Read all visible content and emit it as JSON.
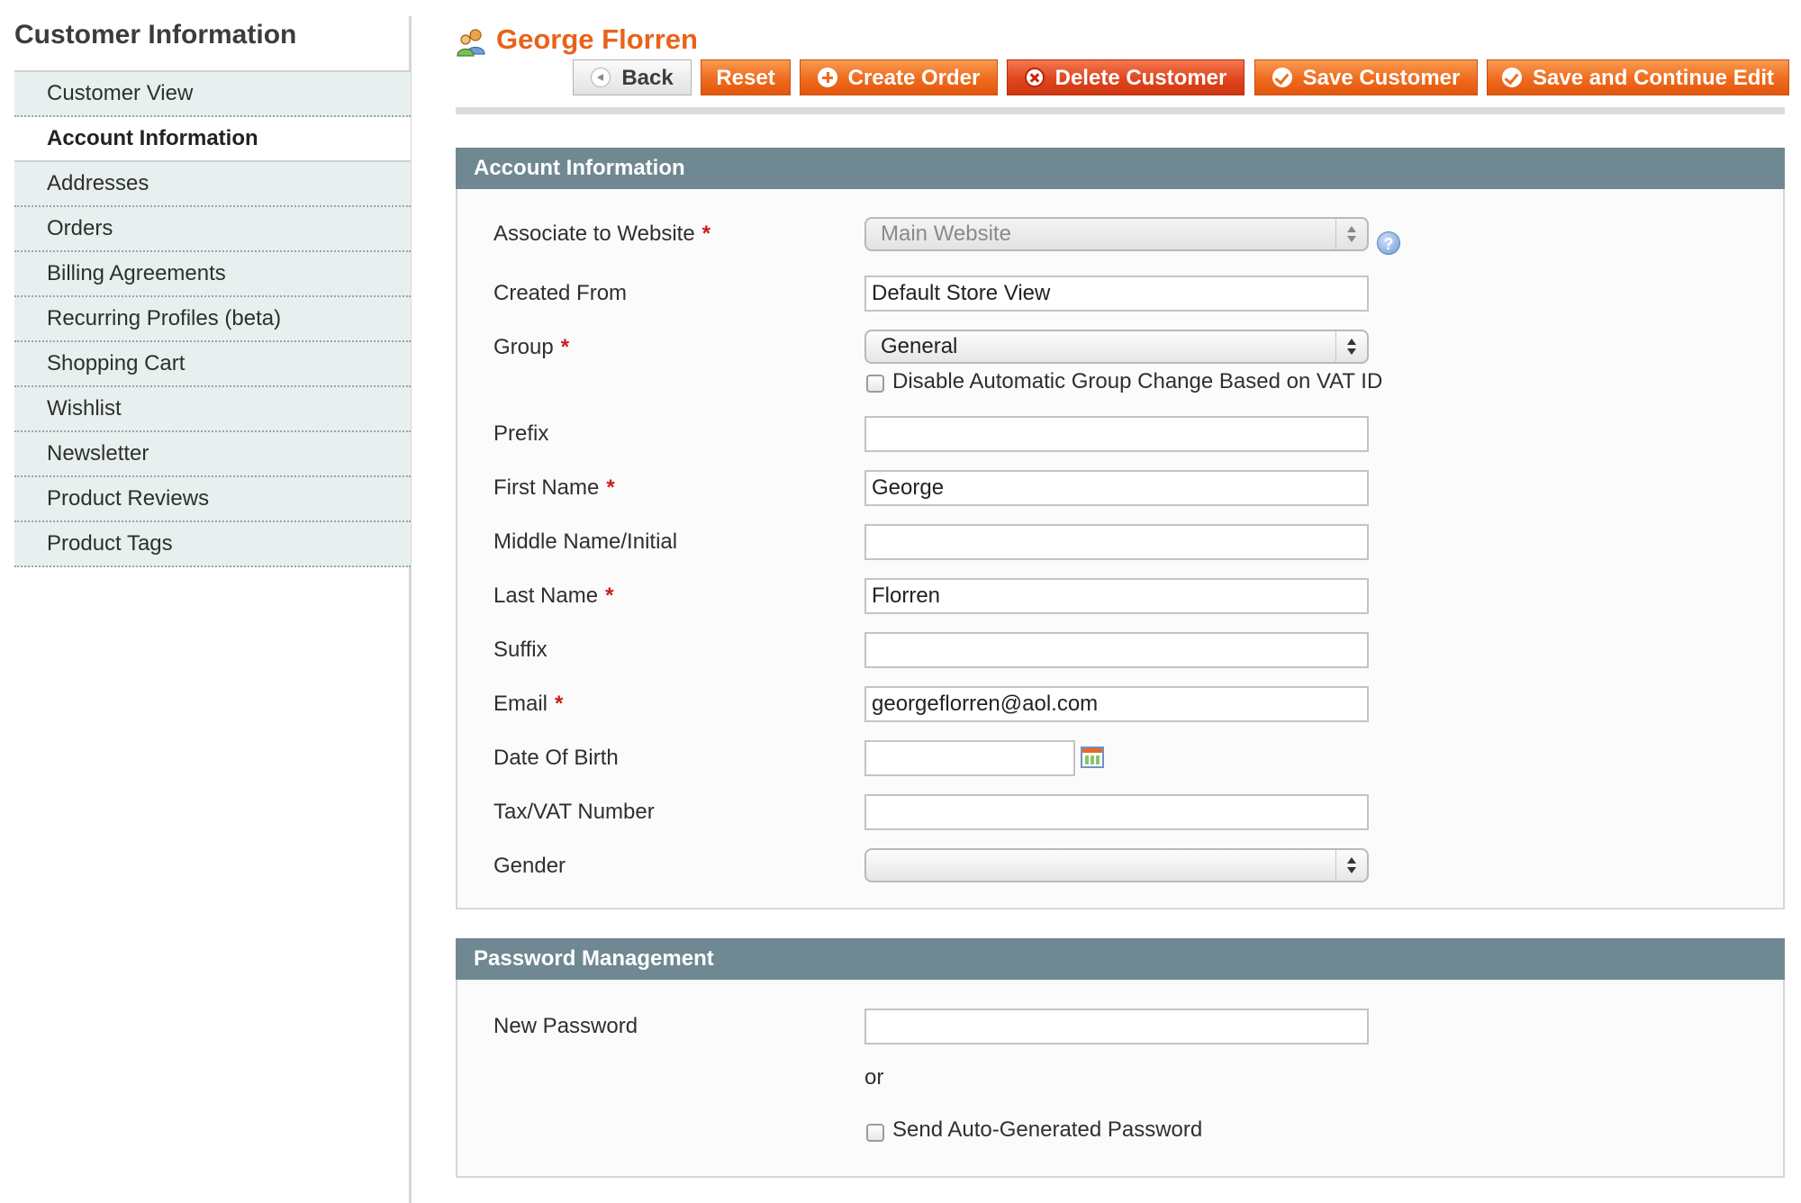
{
  "sidebar": {
    "title": "Customer Information",
    "items": [
      {
        "label": "Customer View"
      },
      {
        "label": "Account Information"
      },
      {
        "label": "Addresses"
      },
      {
        "label": "Orders"
      },
      {
        "label": "Billing Agreements"
      },
      {
        "label": "Recurring Profiles (beta)"
      },
      {
        "label": "Shopping Cart"
      },
      {
        "label": "Wishlist"
      },
      {
        "label": "Newsletter"
      },
      {
        "label": "Product Reviews"
      },
      {
        "label": "Product Tags"
      }
    ]
  },
  "header": {
    "title": "George Florren",
    "buttons": {
      "back": "Back",
      "reset": "Reset",
      "create_order": "Create Order",
      "delete_customer": "Delete Customer",
      "save_customer": "Save Customer",
      "save_continue": "Save and Continue Edit"
    }
  },
  "account": {
    "title": "Account Information",
    "fields": {
      "website": {
        "label": "Associate to Website",
        "value": "Main Website"
      },
      "created_from": {
        "label": "Created From",
        "value": "Default Store View"
      },
      "group": {
        "label": "Group",
        "value": "General"
      },
      "disable_group_change": {
        "label": "Disable Automatic Group Change Based on VAT ID"
      },
      "prefix": {
        "label": "Prefix",
        "value": ""
      },
      "first_name": {
        "label": "First Name",
        "value": "George"
      },
      "middle_name": {
        "label": "Middle Name/Initial",
        "value": ""
      },
      "last_name": {
        "label": "Last Name",
        "value": "Florren"
      },
      "suffix": {
        "label": "Suffix",
        "value": ""
      },
      "email": {
        "label": "Email",
        "value": "georgeflorren@aol.com"
      },
      "dob": {
        "label": "Date Of Birth",
        "value": ""
      },
      "taxvat": {
        "label": "Tax/VAT Number",
        "value": ""
      },
      "gender": {
        "label": "Gender",
        "value": ""
      }
    },
    "required_mark": "*"
  },
  "password": {
    "title": "Password Management",
    "new_password_label": "New Password",
    "or": "or",
    "send_auto_label": "Send Auto-Generated Password"
  }
}
